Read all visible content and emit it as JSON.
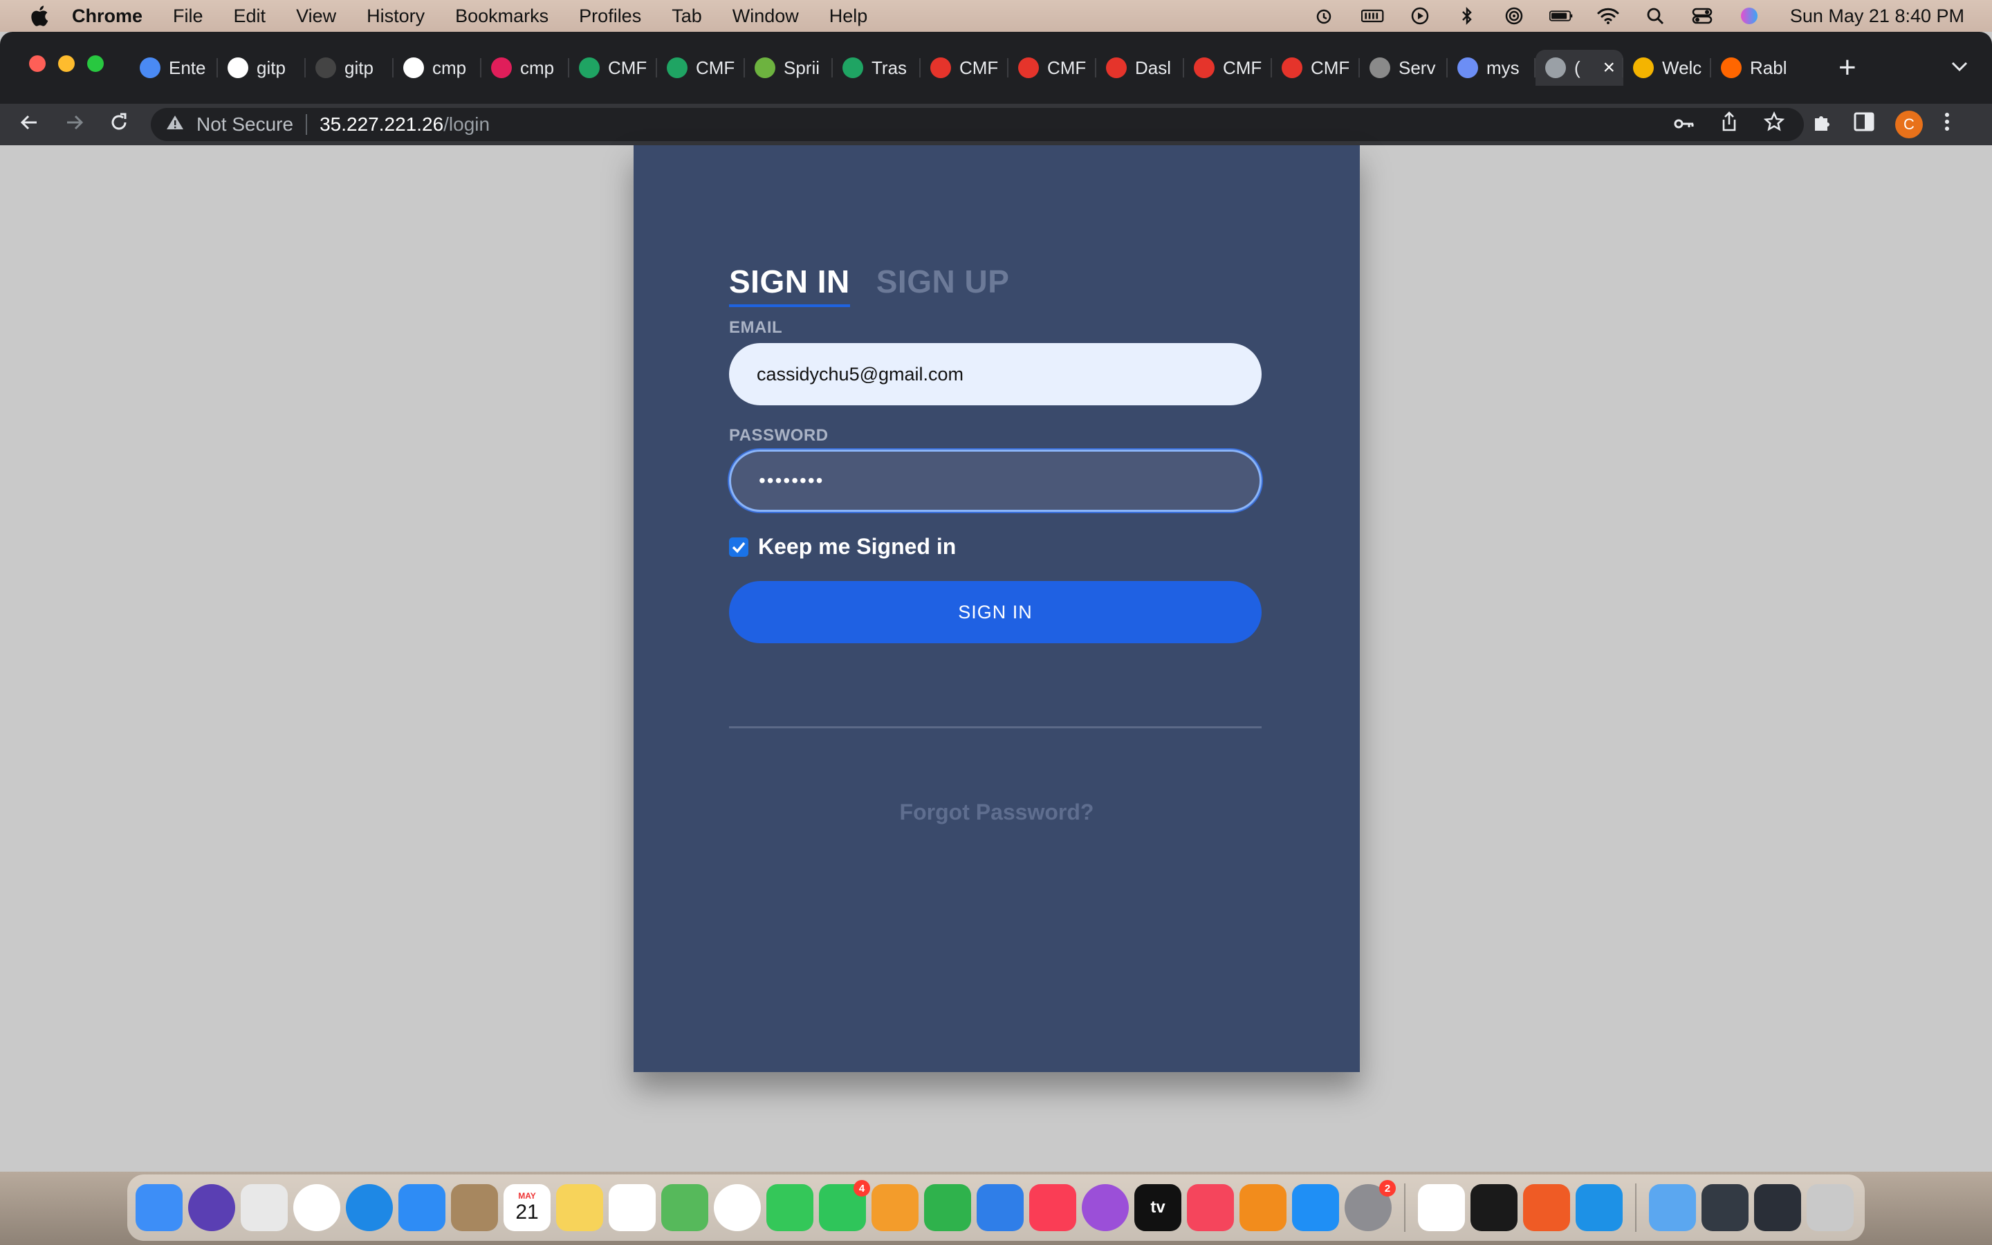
{
  "menubar": {
    "items": [
      "Chrome",
      "File",
      "Edit",
      "View",
      "History",
      "Bookmarks",
      "Profiles",
      "Tab",
      "Window",
      "Help"
    ],
    "clock": "Sun May 21  8:40 PM",
    "icons": [
      "timemachine-icon",
      "battery-meter-icon",
      "play-icon",
      "bluetooth-icon",
      "airdrop-icon",
      "battery-icon",
      "wifi-icon",
      "spotlight-icon",
      "control-center-icon",
      "siri-icon"
    ]
  },
  "tabs": [
    {
      "label": "Ente",
      "icon": "loading-icon",
      "color": "#4a8af4"
    },
    {
      "label": "gitp",
      "icon": "github-icon",
      "color": "#ffffff"
    },
    {
      "label": "gitp",
      "icon": "github-dark-icon",
      "color": "#444444"
    },
    {
      "label": "cmp",
      "icon": "github-icon",
      "color": "#ffffff"
    },
    {
      "label": "cmp",
      "icon": "slack-icon",
      "color": "#e01e5a"
    },
    {
      "label": "CMF",
      "icon": "drive-icon",
      "color": "#1fa463"
    },
    {
      "label": "CMF",
      "icon": "drive-icon",
      "color": "#1fa463"
    },
    {
      "label": "Sprii",
      "icon": "spring-icon",
      "color": "#6db33f"
    },
    {
      "label": "Tras",
      "icon": "drive-icon",
      "color": "#1fa463"
    },
    {
      "label": "CMF",
      "icon": "openshift-icon",
      "color": "#e5342b"
    },
    {
      "label": "CMF",
      "icon": "openshift-icon",
      "color": "#e5342b"
    },
    {
      "label": "Dasl",
      "icon": "openshift-icon",
      "color": "#e5342b"
    },
    {
      "label": "CMF",
      "icon": "openshift-icon",
      "color": "#e5342b"
    },
    {
      "label": "CMF",
      "icon": "openshift-icon",
      "color": "#e5342b"
    },
    {
      "label": "Serv",
      "icon": "gear-icon",
      "color": "#8a8a8a"
    },
    {
      "label": "mys",
      "icon": "layers-icon",
      "color": "#6c8ef5"
    },
    {
      "label": "(",
      "icon": "globe-icon",
      "color": "#9aa0a6",
      "active": true
    },
    {
      "label": "Welc",
      "icon": "gcloud-icon",
      "color": "#f4b400"
    },
    {
      "label": "Rabl",
      "icon": "rabbitmq-icon",
      "color": "#ff6600"
    }
  ],
  "address": {
    "security": "Not Secure",
    "host": "35.227.221.26",
    "path": "/login"
  },
  "profile": {
    "initial": "C"
  },
  "login": {
    "tab_signin": "SIGN IN",
    "tab_signup": "SIGN UP",
    "email_label": "EMAIL",
    "email_value": "cassidychu5@gmail.com",
    "password_label": "PASSWORD",
    "password_value": "••••••••",
    "keep_label": "Keep me Signed in",
    "keep_checked": true,
    "button": "SIGN IN",
    "forgot": "Forgot Password?"
  },
  "dock": {
    "calendar_month": "MAY",
    "calendar_day": "21",
    "facetime_badge": "4",
    "settings_badge": "2",
    "appletv_label": "tv",
    "apps": [
      {
        "name": "finder-icon",
        "color": "#3d8ef7"
      },
      {
        "name": "siri-app-icon",
        "color": "#5a3fb3"
      },
      {
        "name": "launchpad-icon",
        "color": "#e8e8e8"
      },
      {
        "name": "chrome-icon",
        "color": "#ffffff"
      },
      {
        "name": "safari-icon",
        "color": "#1e88e5"
      },
      {
        "name": "mail-icon",
        "color": "#2e8cf5"
      },
      {
        "name": "contacts-icon",
        "color": "#a7875f"
      },
      {
        "name": "calendar-icon",
        "color": "#ffffff"
      },
      {
        "name": "notes-icon",
        "color": "#f7d35a"
      },
      {
        "name": "reminders-icon",
        "color": "#ffffff"
      },
      {
        "name": "maps-icon",
        "color": "#56b95b"
      },
      {
        "name": "photos-icon",
        "color": "#ffffff"
      },
      {
        "name": "messages-icon",
        "color": "#34c759"
      },
      {
        "name": "facetime-icon",
        "color": "#2fc55a"
      },
      {
        "name": "pages-icon",
        "color": "#f39c2b"
      },
      {
        "name": "numbers-icon",
        "color": "#2fb24c"
      },
      {
        "name": "keynote-icon",
        "color": "#2f7ee8"
      },
      {
        "name": "music-icon",
        "color": "#fa3d55"
      },
      {
        "name": "podcasts-icon",
        "color": "#9b4fd8"
      },
      {
        "name": "appletv-icon",
        "color": "#111111"
      },
      {
        "name": "news-icon",
        "color": "#f5455c"
      },
      {
        "name": "books-icon",
        "color": "#f28c1c"
      },
      {
        "name": "appstore-icon",
        "color": "#1f8ff5"
      },
      {
        "name": "system-settings-icon",
        "color": "#8d8d92"
      },
      {
        "name": "vscode-icon",
        "color": "#ffffff"
      },
      {
        "name": "terminal-icon",
        "color": "#1a1a1a"
      },
      {
        "name": "postman-icon",
        "color": "#ef5b25"
      },
      {
        "name": "docker-icon",
        "color": "#1d91e6"
      },
      {
        "name": "folder-icon",
        "color": "#5ba7f0"
      },
      {
        "name": "window-thumb-1-icon",
        "color": "#333a44"
      },
      {
        "name": "window-thumb-2-icon",
        "color": "#2a2f38"
      },
      {
        "name": "trash-icon",
        "color": "#c9c9c9"
      }
    ]
  },
  "colors": {
    "card": "#3a4a6b",
    "primary_button": "#1f61e3",
    "page_bg": "#c9c9c9"
  }
}
